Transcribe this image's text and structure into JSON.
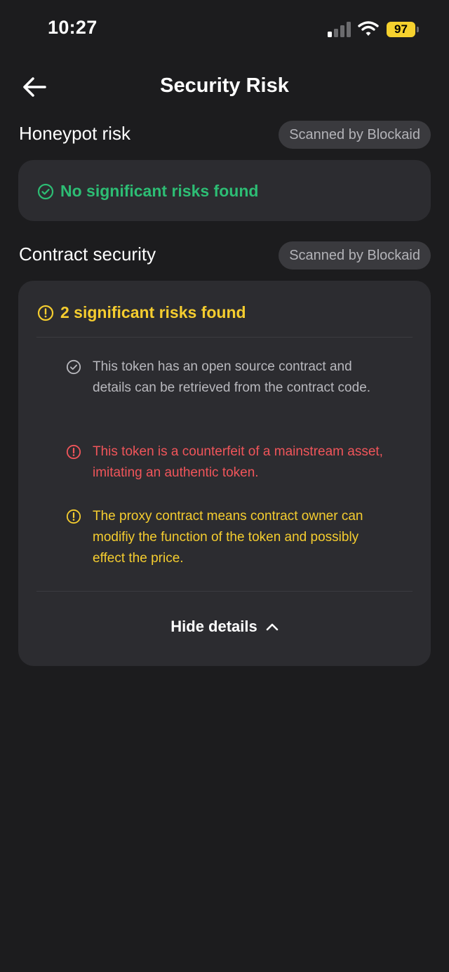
{
  "status_bar": {
    "time": "10:27",
    "battery": "97",
    "icons": [
      "signal-icon",
      "wifi-icon",
      "battery-icon"
    ]
  },
  "header": {
    "title": "Security Risk",
    "back_icon": "arrow-left-icon"
  },
  "honeypot": {
    "title": "Honeypot risk",
    "badge": "Scanned by Blockaid",
    "status": "No significant risks found",
    "status_icon": "check-circle-icon"
  },
  "contract": {
    "title": "Contract security",
    "badge": "Scanned by Blockaid",
    "summary": "2 significant risks found",
    "summary_icon": "alert-circle-icon",
    "items": [
      {
        "icon": "check-circle-icon",
        "text": "This token has an open source contract and details can be retrieved from the contract code.",
        "level": "info"
      },
      {
        "icon": "alert-circle-icon",
        "text": "This token is a counterfeit of a mainstream asset, imitating an authentic token.",
        "level": "danger"
      },
      {
        "icon": "alert-circle-icon",
        "text": "The proxy contract means contract owner can modifiy the function of the token and possibly effect the price.",
        "level": "warning"
      }
    ],
    "toggle_label": "Hide details",
    "toggle_icon": "chevron-up-icon"
  },
  "colors": {
    "background": "#1c1c1e",
    "card": "#2c2c30",
    "success": "#2dbd74",
    "warning": "#f5cd2f",
    "danger": "#f0555a",
    "battery": "#f5d12e"
  }
}
